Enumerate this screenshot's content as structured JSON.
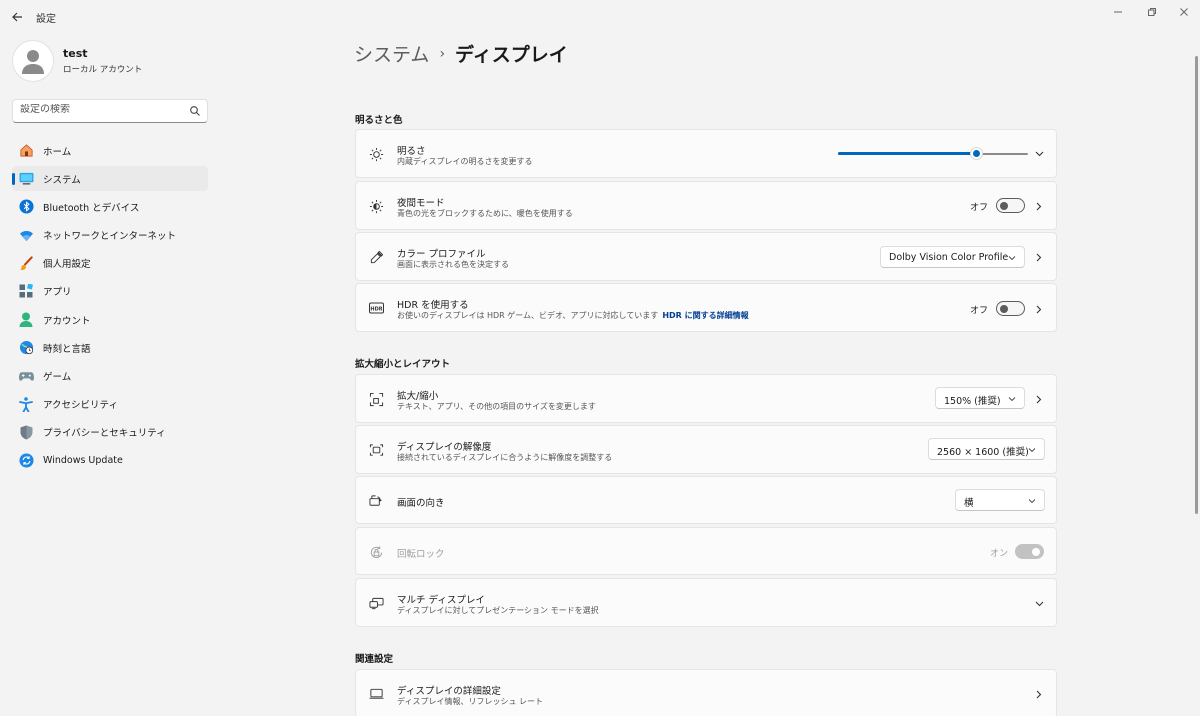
{
  "window": {
    "title": "設定",
    "minimize_icon": "minimize-icon",
    "restore_icon": "restore-icon",
    "close_icon": "close-icon"
  },
  "profile": {
    "name": "test",
    "account_type": "ローカル アカウント"
  },
  "search": {
    "placeholder": "設定の検索"
  },
  "sidebar": {
    "items": [
      {
        "label": "ホーム",
        "icon": "home-icon"
      },
      {
        "label": "システム",
        "icon": "system-icon",
        "active": true
      },
      {
        "label": "Bluetooth とデバイス",
        "icon": "bluetooth-icon"
      },
      {
        "label": "ネットワークとインターネット",
        "icon": "wifi-icon"
      },
      {
        "label": "個人用設定",
        "icon": "brush-icon"
      },
      {
        "label": "アプリ",
        "icon": "apps-icon"
      },
      {
        "label": "アカウント",
        "icon": "account-icon"
      },
      {
        "label": "時刻と言語",
        "icon": "globe-clock-icon"
      },
      {
        "label": "ゲーム",
        "icon": "gamepad-icon"
      },
      {
        "label": "アクセシビリティ",
        "icon": "accessibility-icon"
      },
      {
        "label": "プライバシーとセキュリティ",
        "icon": "shield-icon"
      },
      {
        "label": "Windows Update",
        "icon": "update-icon"
      }
    ]
  },
  "header": {
    "parent": "システム",
    "separator": "›",
    "current": "ディスプレイ"
  },
  "sections": {
    "brightness_color": "明るさと色",
    "scale_layout": "拡大縮小とレイアウト",
    "related": "関連設定"
  },
  "brightness": {
    "title": "明るさ",
    "subtitle": "内蔵ディスプレイの明るさを変更する",
    "level_percent": 73
  },
  "night_mode": {
    "title": "夜間モード",
    "subtitle": "青色の光をブロックするために、暖色を使用する",
    "state": "オフ"
  },
  "color_profile": {
    "title": "カラー プロファイル",
    "subtitle": "画面に表示される色を決定する",
    "value": "Dolby Vision Color Profile"
  },
  "hdr": {
    "title": "HDR を使用する",
    "subtitle": "お使いのディスプレイは HDR ゲーム、ビデオ、アプリに対応しています",
    "link": "HDR に関する詳細情報",
    "state": "オフ"
  },
  "scale": {
    "title": "拡大/縮小",
    "subtitle": "テキスト、アプリ、その他の項目のサイズを変更します",
    "value": "150% (推奨)"
  },
  "resolution": {
    "title": "ディスプレイの解像度",
    "subtitle": "接続されているディスプレイに合うように解像度を調整する",
    "value": "2560 × 1600 (推奨)"
  },
  "orientation": {
    "title": "画面の向き",
    "value": "横"
  },
  "rotation_lock": {
    "title": "回転ロック",
    "state": "オン"
  },
  "multi_display": {
    "title": "マルチ ディスプレイ",
    "subtitle": "ディスプレイに対してプレゼンテーション モードを選択"
  },
  "advanced_display": {
    "title": "ディスプレイの詳細設定",
    "subtitle": "ディスプレイ情報、リフレッシュ レート"
  },
  "colors": {
    "accent": "#0067c0",
    "link": "#003e92",
    "background": "#f3f3f3",
    "card": "#fbfbfb"
  }
}
